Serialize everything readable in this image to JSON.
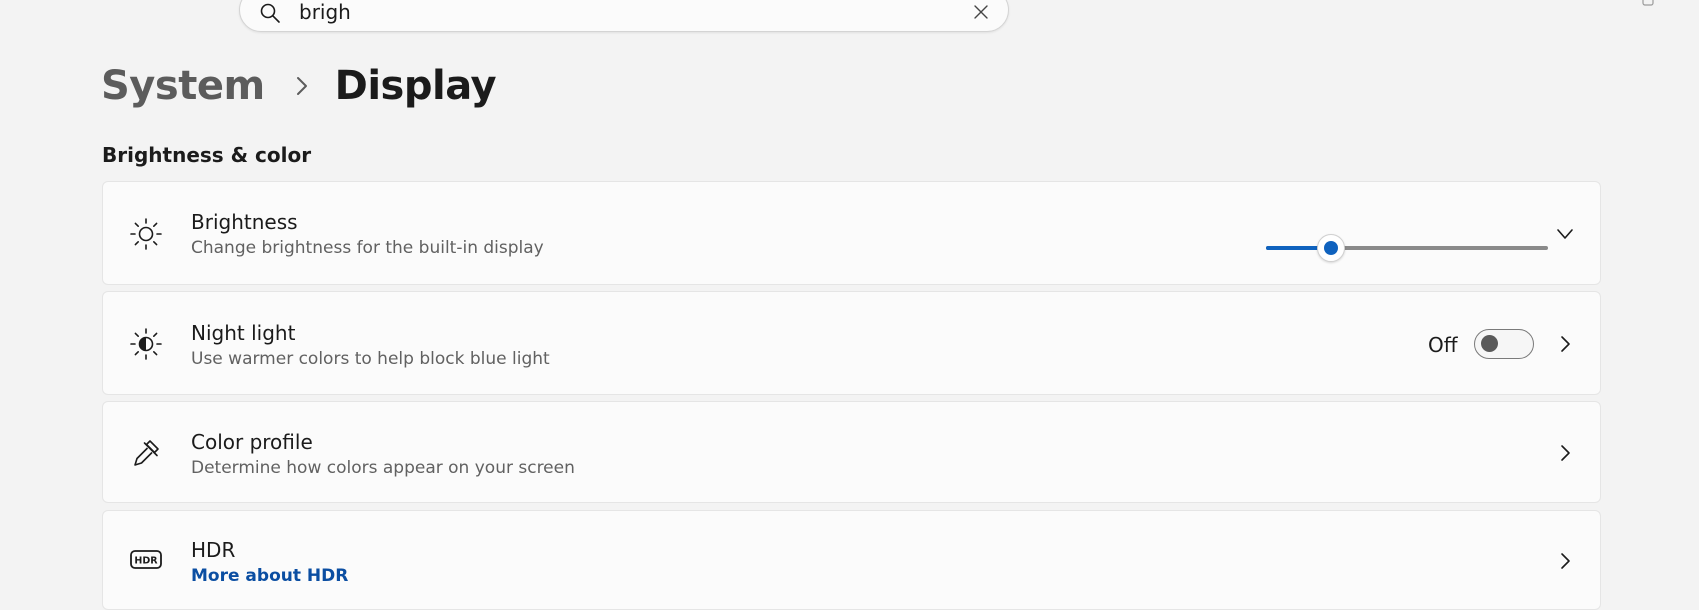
{
  "search": {
    "value": "brigh",
    "icons": {
      "search": "search-icon",
      "clear": "close-icon"
    }
  },
  "breadcrumb": {
    "parent": "System",
    "current": "Display"
  },
  "section": {
    "title": "Brightness & color"
  },
  "settings": {
    "brightness": {
      "title": "Brightness",
      "subtitle": "Change brightness for the built-in display",
      "icon": "sun-icon",
      "level_percent": 23
    },
    "night_light": {
      "title": "Night light",
      "subtitle": "Use warmer colors to help block blue light",
      "icon": "night-light-icon",
      "toggle_label": "Off",
      "toggle_on": false
    },
    "color_profile": {
      "title": "Color profile",
      "subtitle": "Determine how colors appear on your screen",
      "icon": "eyedropper-icon"
    },
    "hdr": {
      "title": "HDR",
      "link": "More about HDR",
      "icon": "hdr-icon"
    }
  },
  "colors": {
    "accent": "#0f62be",
    "background": "#f3f3f3",
    "card": "#fbfbfb",
    "link": "#0b4ea2"
  }
}
